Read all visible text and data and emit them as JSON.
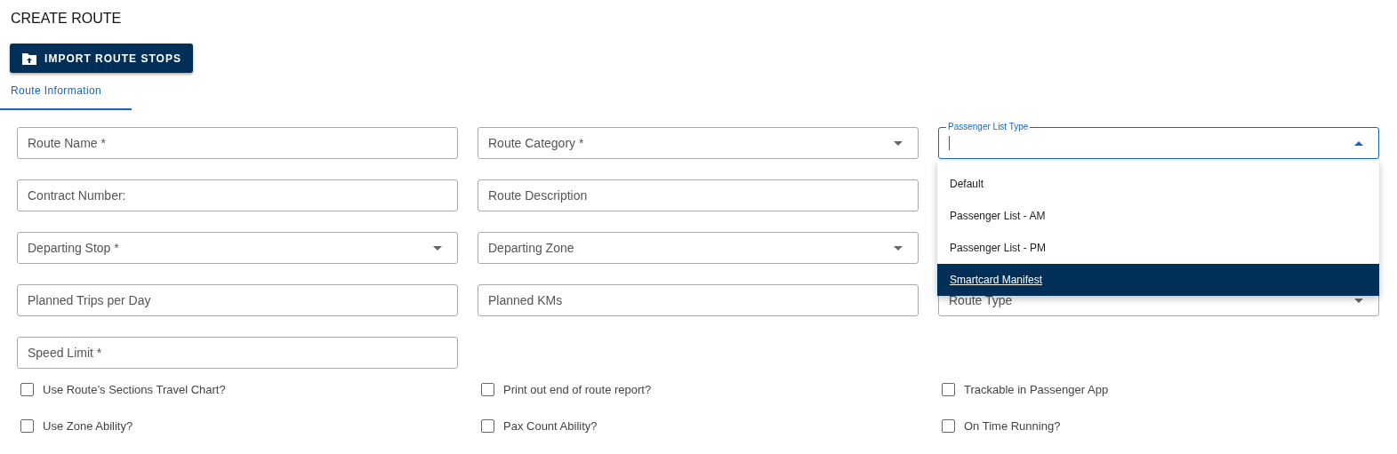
{
  "page_title": "CREATE ROUTE",
  "import_button": {
    "label": "IMPORT ROUTE STOPS"
  },
  "tabs": [
    {
      "label": "Route Information",
      "selected": true
    }
  ],
  "form_columns": [
    {
      "fields": [
        {
          "label": "Route Name *",
          "kind": "text"
        },
        {
          "label": "Contract Number:",
          "kind": "text"
        },
        {
          "label": "Departing Stop *",
          "kind": "select"
        },
        {
          "label": "Planned Trips per Day",
          "kind": "text"
        },
        {
          "label": "Speed Limit *",
          "kind": "text"
        }
      ]
    },
    {
      "fields": [
        {
          "label": "Route Category *",
          "kind": "select"
        },
        {
          "label": "Route Description",
          "kind": "text"
        },
        {
          "label": "Departing Zone",
          "kind": "select"
        },
        {
          "label": "Planned KMs",
          "kind": "text"
        }
      ]
    },
    {
      "fields": [
        {
          "label": "Passenger List Type",
          "kind": "select",
          "focused": true,
          "expanded": true
        },
        {
          "label": "Route Type",
          "kind": "select",
          "focused": false,
          "expanded": false
        }
      ]
    }
  ],
  "dropdown_options": [
    {
      "label": "Default",
      "selected": false
    },
    {
      "label": "Passenger List - AM",
      "selected": false
    },
    {
      "label": "Passenger List - PM",
      "selected": false
    },
    {
      "label": "Smartcard Manifest",
      "selected": true
    }
  ],
  "checkboxes": [
    {
      "label": "Use Route’s Sections Travel Chart?",
      "checked": false
    },
    {
      "label": "Print out end of route report?",
      "checked": false
    },
    {
      "label": "Trackable in Passenger App",
      "checked": false
    },
    {
      "label": "Use Zone Ability?",
      "checked": false
    },
    {
      "label": "Pax Count Ability?",
      "checked": false
    },
    {
      "label": "On Time Running?",
      "checked": false
    }
  ]
}
